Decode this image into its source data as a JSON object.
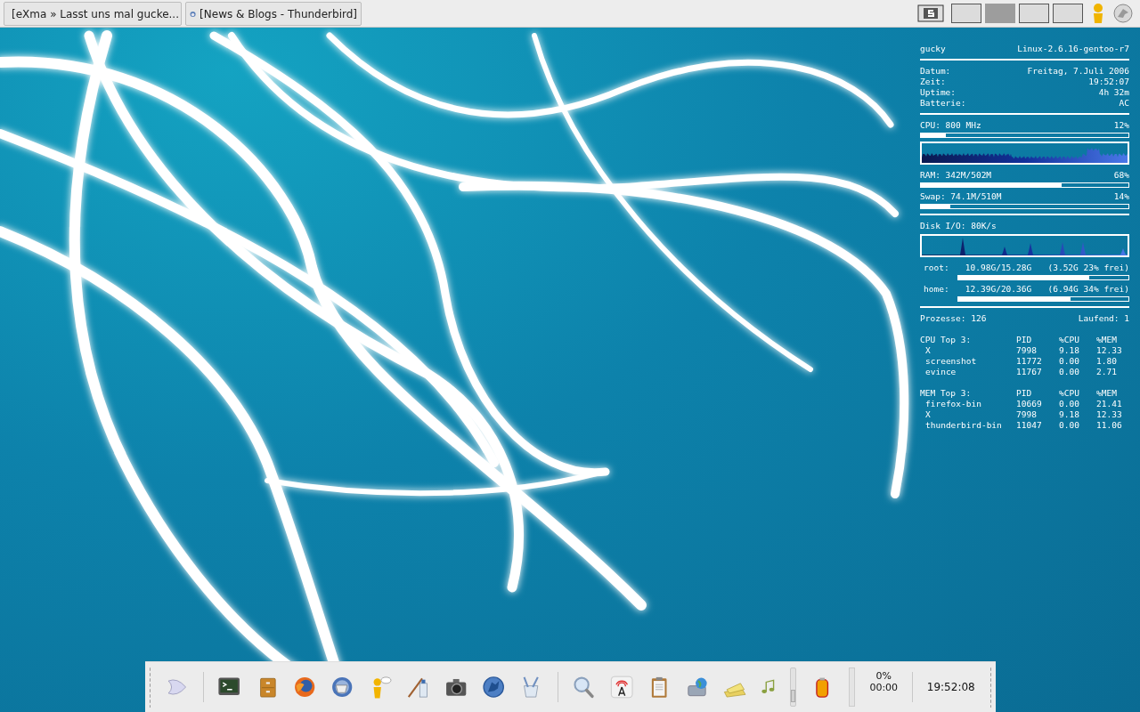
{
  "taskbar": {
    "windows": [
      {
        "title": "[eXma » Lasst uns mal gucke..."
      },
      {
        "title": "[News & Blogs - Thunderbird]"
      }
    ]
  },
  "pager": {
    "desktops": [
      {
        "selected": false
      },
      {
        "selected": true
      },
      {
        "selected": false
      },
      {
        "selected": false
      }
    ]
  },
  "system_monitor": {
    "hostname": "gucky",
    "kernel": "Linux-2.6.16-gentoo-r7",
    "info": [
      {
        "label": "Datum:",
        "value": "Freitag, 7.Juli 2006"
      },
      {
        "label": "Zeit:",
        "value": "19:52:07"
      },
      {
        "label": "Uptime:",
        "value": "4h 32m"
      },
      {
        "label": "Batterie:",
        "value": "AC"
      }
    ],
    "cpu": {
      "label": "CPU: 800 MHz",
      "percent": "12%",
      "level": 0.12
    },
    "ram": {
      "label": "RAM: 342M/502M",
      "percent": "68%",
      "level": 0.68
    },
    "swap": {
      "label": "Swap: 74.1M/510M",
      "percent": "14%",
      "level": 0.14
    },
    "disk_io": "Disk I/O: 80K/s",
    "filesystems": [
      {
        "mount": "root:",
        "usage": "10.98G/15.28G",
        "free": "(3.52G 23% frei)",
        "level": 0.77
      },
      {
        "mount": "home:",
        "usage": "12.39G/20.36G",
        "free": "(6.94G 34% frei)",
        "level": 0.66
      }
    ],
    "processes": "Prozesse: 126",
    "running": "Laufend: 1",
    "top_lists": [
      {
        "title": "CPU Top 3:",
        "columns": [
          "PID",
          "%CPU",
          "%MEM"
        ],
        "rows": [
          {
            "name": "X",
            "pid": "7998",
            "cpu": "9.18",
            "mem": "12.33"
          },
          {
            "name": "screenshot",
            "pid": "11772",
            "cpu": "0.00",
            "mem": "1.80"
          },
          {
            "name": "evince",
            "pid": "11767",
            "cpu": "0.00",
            "mem": "2.71"
          }
        ]
      },
      {
        "title": "MEM Top 3:",
        "columns": [
          "PID",
          "%CPU",
          "%MEM"
        ],
        "rows": [
          {
            "name": "firefox-bin",
            "pid": "10669",
            "cpu": "0.00",
            "mem": "21.41"
          },
          {
            "name": "X",
            "pid": "7998",
            "cpu": "9.18",
            "mem": "12.33"
          },
          {
            "name": "thunderbird-bin",
            "pid": "11047",
            "cpu": "0.00",
            "mem": "11.06"
          }
        ]
      }
    ]
  },
  "dock": {
    "volume": {
      "level": 0.2
    },
    "battery": {
      "percent": "0%",
      "time": "00:00"
    },
    "clock": "19:52:08"
  }
}
